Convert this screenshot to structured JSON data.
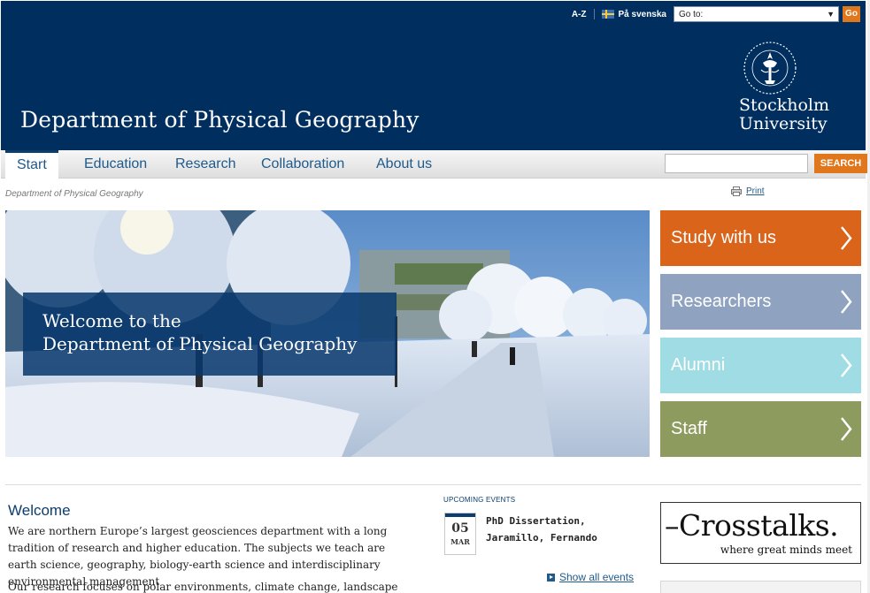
{
  "utility": {
    "az": "A-Z",
    "swedish": "På svenska",
    "goto_label": "Go to:",
    "go_button": "Go"
  },
  "header": {
    "title": "Department of Physical Geography",
    "logo_line1": "Stockholm",
    "logo_line2": "University"
  },
  "nav": {
    "items": [
      "Start",
      "Education",
      "Research",
      "Collaboration",
      "About us"
    ],
    "search_button": "SEARCH",
    "search_value": ""
  },
  "breadcrumb": "Department of Physical Geography",
  "print": "Print",
  "hero": {
    "line1": "Welcome to the",
    "line2": "Department of Physical Geography"
  },
  "tiles": [
    {
      "label": "Study with us",
      "color": "#d9641a"
    },
    {
      "label": "Researchers",
      "color": "#8fa3c0"
    },
    {
      "label": "Alumni",
      "color": "#9fdce4"
    },
    {
      "label": "Staff",
      "color": "#8e9b5f"
    }
  ],
  "welcome": {
    "heading": "Welcome",
    "para1": "We are northern Europe’s largest geosciences department with a long tradition of research and higher education. The subjects we teach are earth science, geography, biology-earth science and interdisciplinary environmental management",
    "para2": "Our research focuses on polar environments, climate change, landscape evolution,"
  },
  "events": {
    "heading": "UPCOMING EVENTS",
    "day": "05",
    "month": "MAR",
    "title": "PhD Dissertation, Jaramillo, Fernando",
    "show_all": "Show all events"
  },
  "crosstalks": {
    "main": "–Crosstalks.",
    "tagline": "where great minds meet"
  },
  "colors": {
    "header_bg": "#002f5f",
    "accent": "#e1771c",
    "link": "#1f5a8c"
  }
}
